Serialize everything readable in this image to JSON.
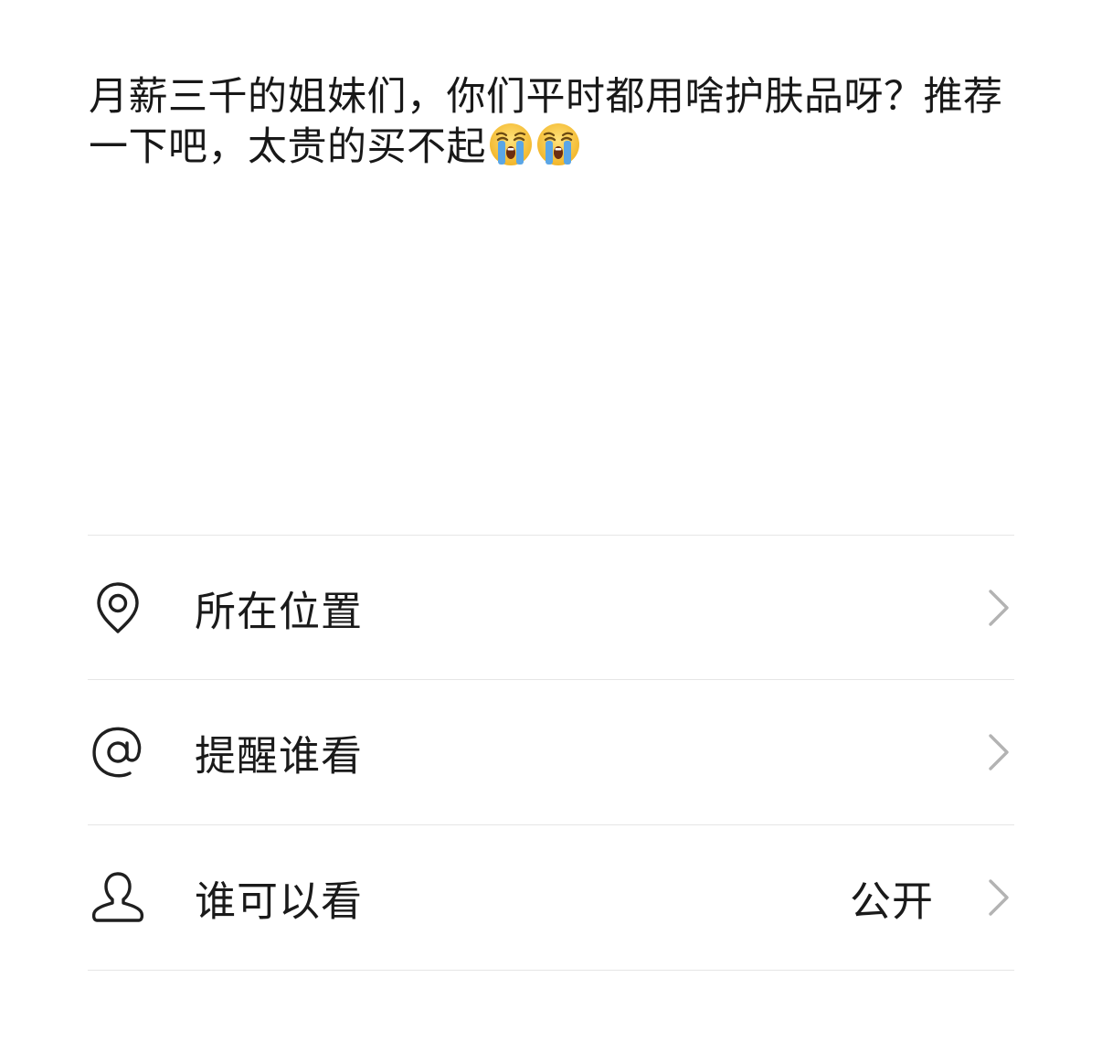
{
  "post": {
    "text": "月薪三千的姐妹们，你们平时都用啥护肤品呀？推荐一下吧，太贵的买不起",
    "emojis": [
      "loudly-crying-face",
      "loudly-crying-face"
    ]
  },
  "options": [
    {
      "id": "location",
      "icon": "location-pin-icon",
      "label": "所在位置",
      "value": ""
    },
    {
      "id": "mention",
      "icon": "at-sign-icon",
      "label": "提醒谁看",
      "value": ""
    },
    {
      "id": "visibility",
      "icon": "person-icon",
      "label": "谁可以看",
      "value": "公开"
    }
  ],
  "colors": {
    "text": "#1a1a1a",
    "divider": "#e6e6e6",
    "icon_stroke": "#1f1f1f",
    "chevron": "#b3b3b3",
    "emoji_face": "#f7c33b",
    "emoji_tears": "#5aa6e6"
  }
}
